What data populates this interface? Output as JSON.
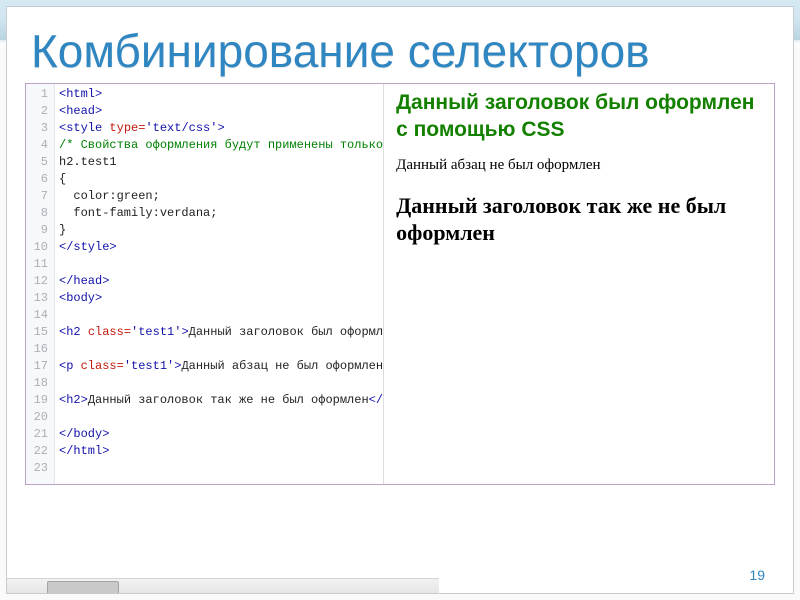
{
  "slide": {
    "title": "Комбинирование селекторов",
    "page_number": "19"
  },
  "code": {
    "lines": [
      {
        "n": "1",
        "html": "<span class='tag'>&lt;html&gt;</span>"
      },
      {
        "n": "2",
        "html": "<span class='tag'>&lt;head&gt;</span>"
      },
      {
        "n": "3",
        "html": "<span class='tag'>&lt;style</span> <span class='attr'>type=</span><span class='str'>'text/css'</span><span class='tag'>&gt;</span>"
      },
      {
        "n": "4",
        "html": "<span class='comment'>/* Свойства оформления будут применены только</span>"
      },
      {
        "n": "5",
        "html": "<span class='txt'>h2.test1</span>"
      },
      {
        "n": "6",
        "html": "<span class='txt'>{</span>"
      },
      {
        "n": "7",
        "html": "<span class='txt'>  color:green;</span>"
      },
      {
        "n": "8",
        "html": "<span class='txt'>  font-family:verdana;</span>"
      },
      {
        "n": "9",
        "html": "<span class='txt'>}</span>"
      },
      {
        "n": "10",
        "html": "<span class='tag'>&lt;/style&gt;</span>"
      },
      {
        "n": "11",
        "html": ""
      },
      {
        "n": "12",
        "html": "<span class='tag'>&lt;/head&gt;</span>"
      },
      {
        "n": "13",
        "html": "<span class='tag'>&lt;body&gt;</span>"
      },
      {
        "n": "14",
        "html": ""
      },
      {
        "n": "15",
        "html": "<span class='tag'>&lt;h2</span> <span class='attr'>class=</span><span class='str'>'test1'</span><span class='tag'>&gt;</span><span class='txt'>Данный заголовок был оформл</span>"
      },
      {
        "n": "16",
        "html": ""
      },
      {
        "n": "17",
        "html": "<span class='tag'>&lt;p</span> <span class='attr'>class=</span><span class='str'>'test1'</span><span class='tag'>&gt;</span><span class='txt'>Данный абзац не был оформлен</span>"
      },
      {
        "n": "18",
        "html": ""
      },
      {
        "n": "19",
        "html": "<span class='tag'>&lt;h2&gt;</span><span class='txt'>Данный заголовок так же не был оформлен</span><span class='tag'>&lt;/</span>"
      },
      {
        "n": "20",
        "html": ""
      },
      {
        "n": "21",
        "html": "<span class='tag'>&lt;/body&gt;</span>"
      },
      {
        "n": "22",
        "html": "<span class='tag'>&lt;/html&gt;</span>"
      },
      {
        "n": "23",
        "html": ""
      }
    ]
  },
  "preview": {
    "h2_css": "Данный заголовок был оформлен с помощью CSS",
    "p_plain": "Данный абзац не был оформлен",
    "h2_plain": "Данный заголовок так же не был оформлен"
  }
}
